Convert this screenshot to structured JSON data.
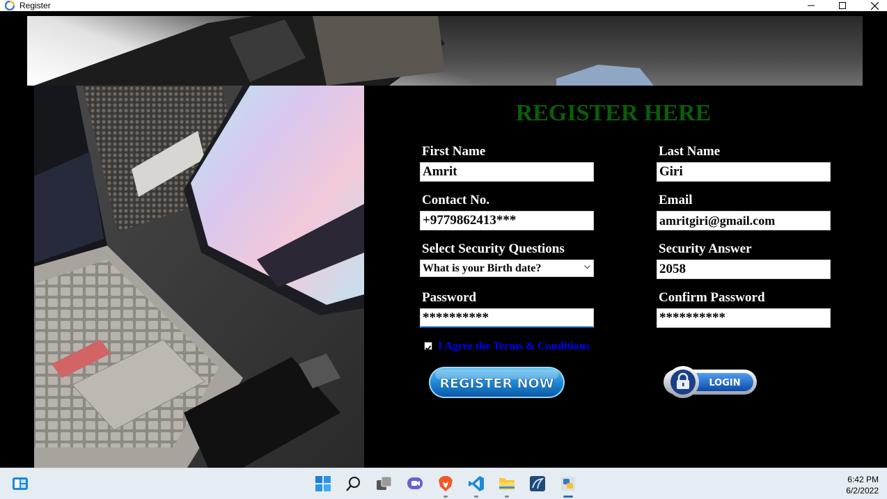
{
  "window": {
    "title": "Register",
    "icon": "python-app-icon"
  },
  "form": {
    "heading": "REGISTER HERE",
    "first_name": {
      "label": "First Name",
      "value": "Amrit"
    },
    "last_name": {
      "label": "Last Name",
      "value": "Giri"
    },
    "contact": {
      "label": "Contact No.",
      "value": "+9779862413***"
    },
    "email": {
      "label": "Email",
      "value": "amritgiri@gmail.com"
    },
    "security_question": {
      "label": "Select Security Questions",
      "value": "What is your Birth date?"
    },
    "security_answer": {
      "label": "Security Answer",
      "value": "2058"
    },
    "password": {
      "label": "Password",
      "value": "**********"
    },
    "confirm_password": {
      "label": "Confirm Password",
      "value": "**********"
    },
    "agree": {
      "label": "I Agree the Terms & Conditions",
      "checked": true
    },
    "register_button": "REGISTER NOW",
    "login_button": "LOGIN"
  },
  "colors": {
    "heading": "#0b5d0b",
    "agree_text": "#0000ff",
    "register_button": "#1e88d6",
    "login_button": "#1767c9"
  },
  "taskbar": {
    "icons": [
      "widgets-icon",
      "start-icon",
      "search-icon",
      "task-view-icon",
      "chat-icon",
      "brave-browser-icon",
      "vscode-icon",
      "file-explorer-icon",
      "mysql-workbench-icon",
      "python-icon"
    ],
    "time": "6:42 PM",
    "date": "6/2/2022"
  }
}
